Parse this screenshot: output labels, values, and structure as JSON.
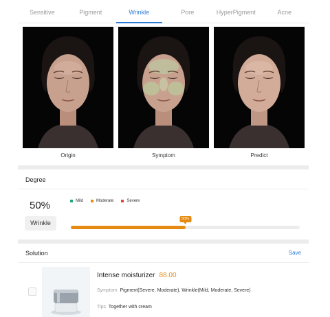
{
  "tabs": [
    {
      "label": "Sensitive",
      "active": false
    },
    {
      "label": "Pigment",
      "active": false
    },
    {
      "label": "Wrinkle",
      "active": true
    },
    {
      "label": "Pore",
      "active": false
    },
    {
      "label": "HyperPigment",
      "active": false
    },
    {
      "label": "Acne",
      "active": false
    }
  ],
  "images": {
    "origin_caption": "Origin",
    "symptom_caption": "Symptom",
    "predict_caption": "Predict"
  },
  "degree": {
    "title": "Degree",
    "percent_text": "50%",
    "badge": "Wrinkle",
    "level": 0.5,
    "bubble_text": "50%",
    "legend": [
      {
        "label": "Mild",
        "color": "#2aa57a"
      },
      {
        "label": "Moderate",
        "color": "#e58b11"
      },
      {
        "label": "Severe",
        "color": "#e0483e"
      }
    ]
  },
  "solution": {
    "title": "Solution",
    "save_label": "Save",
    "product": {
      "name": "Intense moisturizer",
      "price": "88.00",
      "symptom_label": "Symptom",
      "symptom_value": "Pigment(Severe, Moderate), Wrinkle(Mild, Moderate, Severe)",
      "tips_label": "Tips",
      "tips_value": "Together with cream"
    }
  },
  "colors": {
    "accent": "#2e7bd6",
    "progress": "#e58b11"
  }
}
